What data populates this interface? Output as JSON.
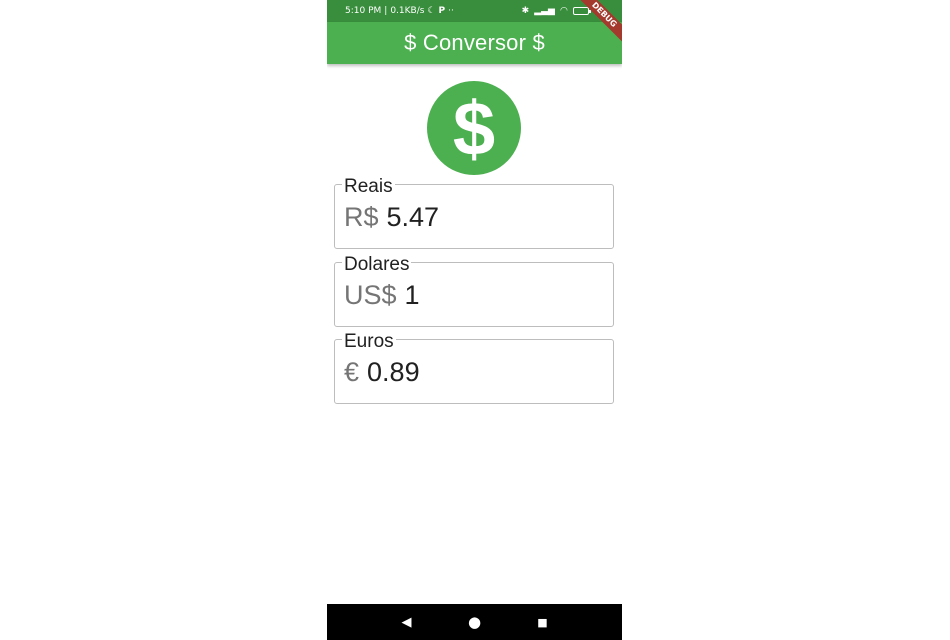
{
  "status_bar": {
    "time": "5:10 PM",
    "net_speed": "0.1KB/s",
    "battery": "23"
  },
  "app_bar": {
    "title": "$ Conversor $",
    "debug_banner": "DEBUG"
  },
  "colors": {
    "primary": "#4caf50",
    "primary_dark": "#388e3c",
    "icon_symbol": "#ffffff"
  },
  "icon": {
    "name": "monetization-icon",
    "symbol": "$"
  },
  "fields": [
    {
      "label": "Reais",
      "prefix": "R$",
      "value": "5.47"
    },
    {
      "label": "Dolares",
      "prefix": "US$",
      "value": "1"
    },
    {
      "label": "Euros",
      "prefix": "€",
      "value": "0.89"
    }
  ],
  "nav": {
    "back_icon": "◀",
    "home_icon": "●",
    "recents_icon": "■"
  }
}
